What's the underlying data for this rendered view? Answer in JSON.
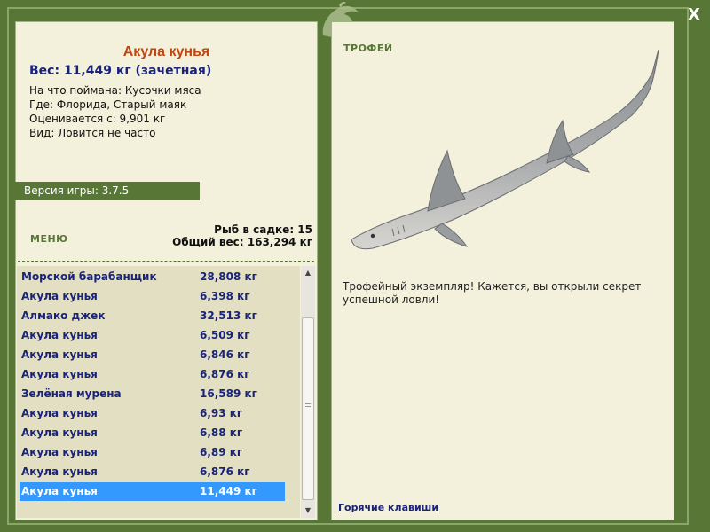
{
  "close_label": "X",
  "catch": {
    "name": "Акула кунья",
    "weight_line": "Вес: 11,449 кг (зачетная)",
    "caught_with": "На что поймана: Кусочки мяса",
    "location": "Где: Флорида, Старый маяк",
    "valued_from": "Оценивается с: 9,901 кг",
    "rarity": "Вид: Ловится не часто"
  },
  "version": "Версия игры: 3.7.5",
  "menu_label": "МЕНЮ",
  "keep_net": {
    "count_line": "Рыб в садке: 15",
    "total_line": "Общий вес: 163,294 кг"
  },
  "fish_list": [
    {
      "name": "Морской барабанщик",
      "weight": "28,808 кг"
    },
    {
      "name": "Акула кунья",
      "weight": "6,398 кг"
    },
    {
      "name": "Алмако джек",
      "weight": "32,513 кг"
    },
    {
      "name": "Акула кунья",
      "weight": "6,509 кг"
    },
    {
      "name": "Акула кунья",
      "weight": "6,846 кг"
    },
    {
      "name": "Акула кунья",
      "weight": "6,876 кг"
    },
    {
      "name": "Зелёная мурена",
      "weight": "16,589 кг"
    },
    {
      "name": "Акула кунья",
      "weight": "6,93 кг"
    },
    {
      "name": "Акула кунья",
      "weight": "6,88 кг"
    },
    {
      "name": "Акула кунья",
      "weight": "6,89 кг"
    },
    {
      "name": "Акула кунья",
      "weight": "6,876 кг"
    },
    {
      "name": "Акула кунья",
      "weight": "11,449 кг"
    }
  ],
  "selected_index": 11,
  "trophy": {
    "label": "ТРОФЕЙ",
    "text": "Трофейный экземпляр! Кажется, вы открыли секрет успешной ловли!"
  },
  "hotkeys_label": "Горячие клавиши",
  "icons": {
    "close": "close-icon",
    "logo": "dolphin-logo-icon",
    "scroll_up": "scroll-up-arrow-icon",
    "scroll_down": "scroll-down-arrow-icon"
  },
  "colors": {
    "frame": "#587636",
    "panel": "#f3f0dc",
    "list_bg": "#e3dfc3",
    "fish_name": "#c0450e",
    "text_blue": "#1a237a",
    "selection": "#3399ff"
  }
}
